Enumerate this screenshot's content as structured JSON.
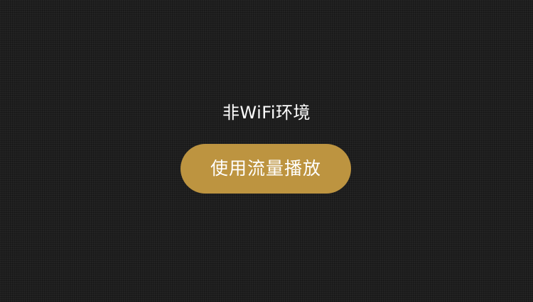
{
  "notice": {
    "message": "非WiFi环境"
  },
  "action": {
    "play_label": "使用流量播放"
  },
  "colors": {
    "background": "#1f1f1f",
    "button": "#bd9440",
    "text": "#ffffff"
  }
}
